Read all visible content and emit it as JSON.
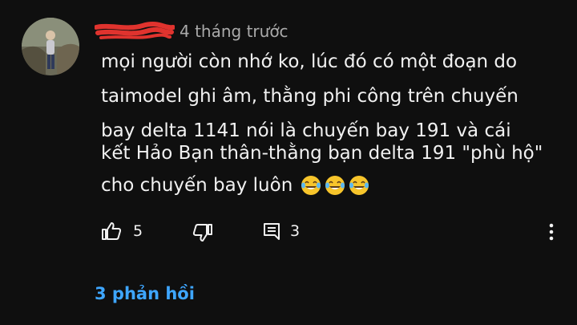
{
  "comment": {
    "timestamp": "4 tháng trước",
    "text_lines": [
      "mọi người còn nhớ ko, lúc đó có một đoạn do",
      "taimodel ghi âm, thằng phi công trên chuyến",
      "bay delta 1141 nói là chuyến bay 191 và cái",
      "kết Hảo Bạn thân-thằng bạn delta 191 \"phù hộ\"",
      "cho chuyến bay luôn"
    ],
    "emoji_count": 3
  },
  "actions": {
    "like_count": "5",
    "reply_count": "3",
    "like_icon": "thumb-up-icon",
    "dislike_icon": "thumb-down-icon",
    "reply_icon": "comment-icon",
    "more_icon": "more-vert-icon"
  },
  "replies": {
    "label": "3 phản hồi"
  },
  "colors": {
    "background": "#0f0f0f",
    "text": "#f1f1f1",
    "secondary_text": "#aaaaaa",
    "link": "#3ea6ff",
    "redaction": "#e0332e"
  }
}
